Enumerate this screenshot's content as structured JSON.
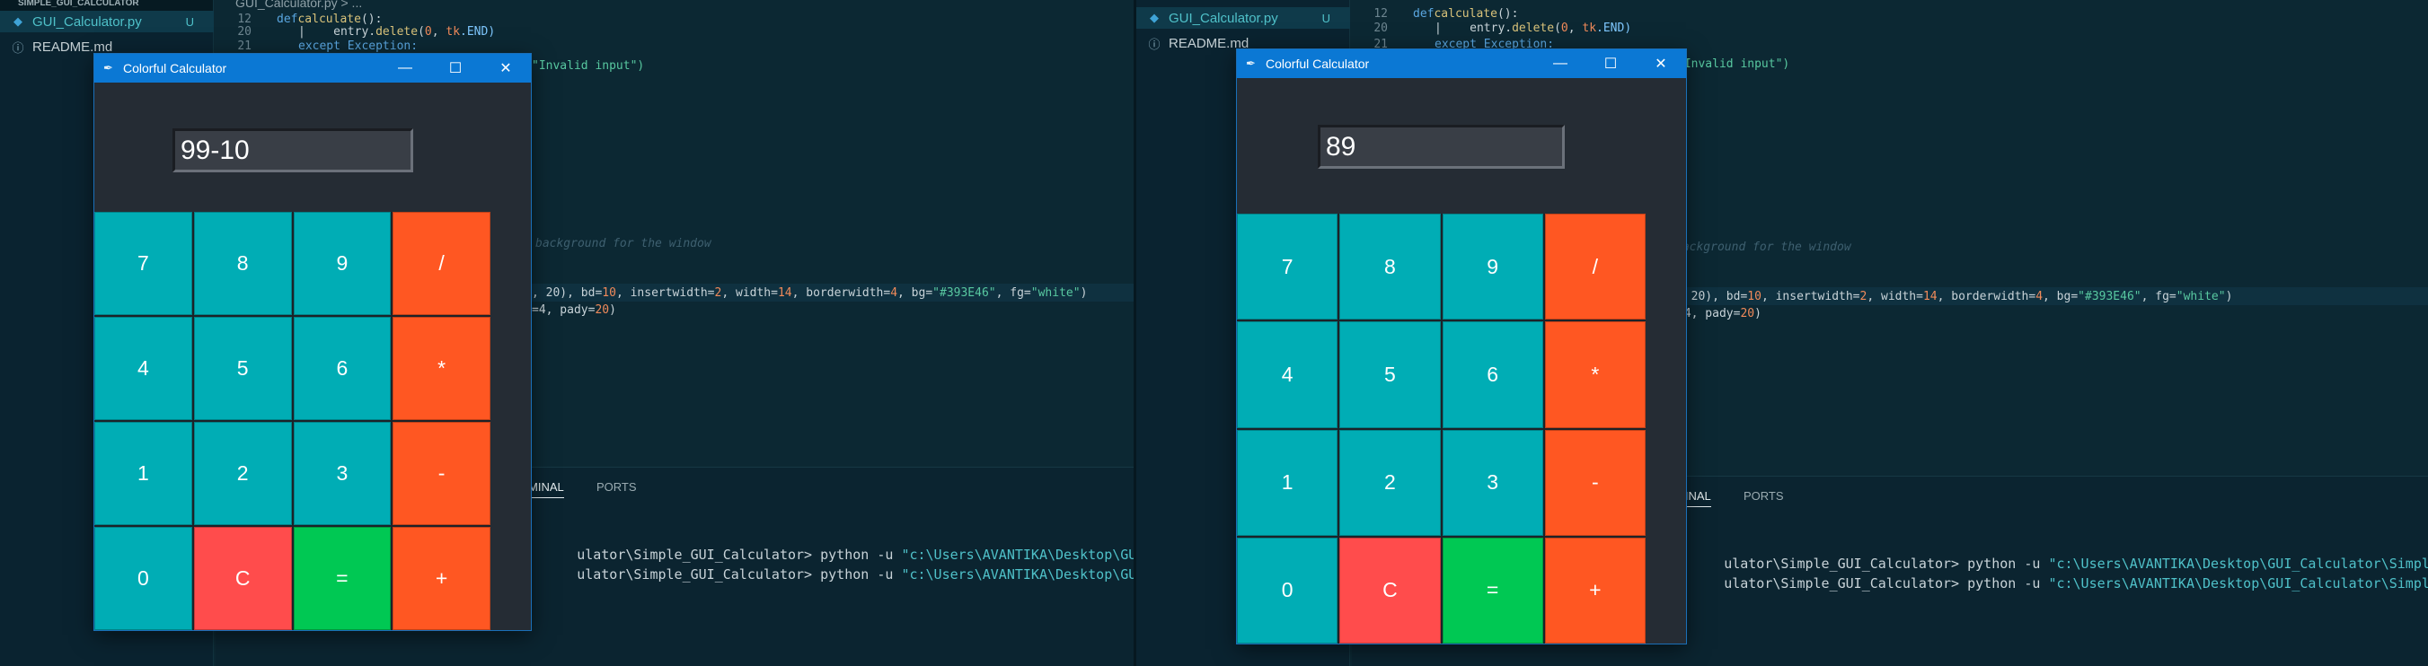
{
  "explorer": {
    "section": "SIMPLE_GUI_CALCULATOR",
    "files": [
      {
        "name": "GUI_Calculator.py",
        "badge": "U",
        "icon": "python-file-icon"
      },
      {
        "name": "README.md",
        "badge": "",
        "icon": "info-icon"
      }
    ]
  },
  "editor": {
    "tab": "GUI_Calculator.py > ...",
    "line_numbers": {
      "l12": "12",
      "l20": "20",
      "l21": "21"
    },
    "code": {
      "def_kw": "def",
      "def_fn": "calculate",
      "def_rest": "():",
      "l20_pre": "|    entry.",
      "l20_fn": "delete",
      "l20_open": "(",
      "l20_num": "0",
      "l20_mid": ", ",
      "l20_tk": "tk",
      "l20_end": ".END)",
      "l21": "except Exception:",
      "invalid": "\"Invalid input\")",
      "comment": "background for the window",
      "entry_a": ", 20), bd=",
      "entry_bd": "10",
      "entry_b": ", insertwidth=",
      "entry_iw": "2",
      "entry_c": ", width=",
      "entry_w": "14",
      "entry_d": ", borderwidth=",
      "entry_bw": "4",
      "entry_e": ", bg=",
      "entry_bg": "\"#393E46\"",
      "entry_f": ", fg=",
      "entry_fg": "\"white\"",
      "entry_g": ")",
      "grid_a": "=4, pady=",
      "grid_b": "20",
      "grid_c": ")"
    }
  },
  "panel": {
    "tabs": [
      "TERMINAL",
      "PORTS"
    ],
    "left_tab_visible": "MINAL",
    "right_tab_visible": "MINAL",
    "term_prefix": "ulator\\Simple_GUI_Calculator>",
    "term_cmd": " python -u ",
    "left_path": "\"c:\\Users\\AVANTIKA\\Desktop\\GUI_Calcul",
    "left_path2": "\"c:\\Users\\AVANTIKA\\Desktop\\GUI_Calcul",
    "right_path": "\"c:\\Users\\AVANTIKA\\Desktop\\GUI_Calculator\\Simple_GUI",
    "right_path2": "\"c:\\Users\\AVANTIKA\\Desktop\\GUI_Calculator\\Simple_GUI"
  },
  "calc_left": {
    "title": "Colorful Calculator",
    "display": "99-10"
  },
  "calc_right": {
    "title": "Colorful Calculator",
    "display": "89"
  },
  "window_controls": {
    "minimize": "—",
    "maximize": "☐",
    "close": "✕"
  },
  "keys": [
    {
      "label": "7",
      "kind": "num",
      "name": "key-7"
    },
    {
      "label": "8",
      "kind": "num",
      "name": "key-8"
    },
    {
      "label": "9",
      "kind": "num",
      "name": "key-9"
    },
    {
      "label": "/",
      "kind": "op",
      "name": "key-divide"
    },
    {
      "label": "4",
      "kind": "num",
      "name": "key-4"
    },
    {
      "label": "5",
      "kind": "num",
      "name": "key-5"
    },
    {
      "label": "6",
      "kind": "num",
      "name": "key-6"
    },
    {
      "label": "*",
      "kind": "op",
      "name": "key-multiply"
    },
    {
      "label": "1",
      "kind": "num",
      "name": "key-1"
    },
    {
      "label": "2",
      "kind": "num",
      "name": "key-2"
    },
    {
      "label": "3",
      "kind": "num",
      "name": "key-3"
    },
    {
      "label": "-",
      "kind": "op",
      "name": "key-subtract"
    },
    {
      "label": "0",
      "kind": "num",
      "name": "key-0"
    },
    {
      "label": "C",
      "kind": "clr",
      "name": "key-clear"
    },
    {
      "label": "=",
      "kind": "eq",
      "name": "key-equals"
    },
    {
      "label": "+",
      "kind": "op",
      "name": "key-add"
    }
  ],
  "colors": {
    "digit": "#00ADB5",
    "operator": "#FF5722",
    "clear": "#FF4C4C",
    "equals": "#00C853",
    "display_bg": "#393E46",
    "titlebar": "#0b78d4"
  }
}
